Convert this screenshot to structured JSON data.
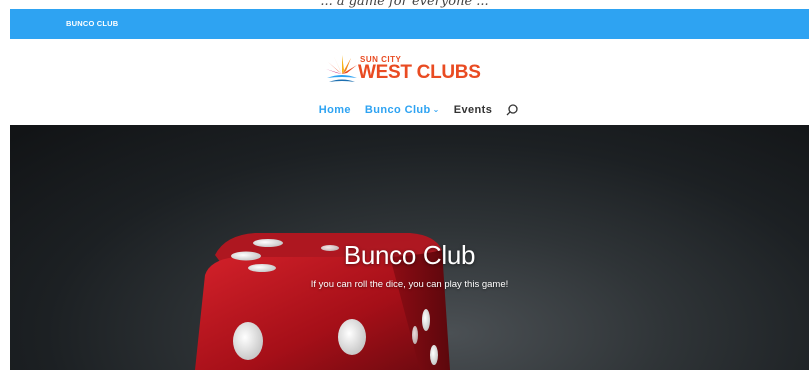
{
  "caption": "... a game for everyone ...",
  "topbar": {
    "club_link": "BUNCO CLUB"
  },
  "logo": {
    "line1": "SUN CITY",
    "line2": "WEST CLUBS"
  },
  "nav": {
    "items": [
      {
        "label": "Home"
      },
      {
        "label": "Bunco Club"
      },
      {
        "label": "Events"
      }
    ]
  },
  "hero": {
    "title": "Bunco Club",
    "subtitle": "If you can roll the dice, you can play this game!"
  },
  "colors": {
    "accent": "#2ea3f2",
    "logo": "#e94b22",
    "dice": "#b5121b"
  }
}
